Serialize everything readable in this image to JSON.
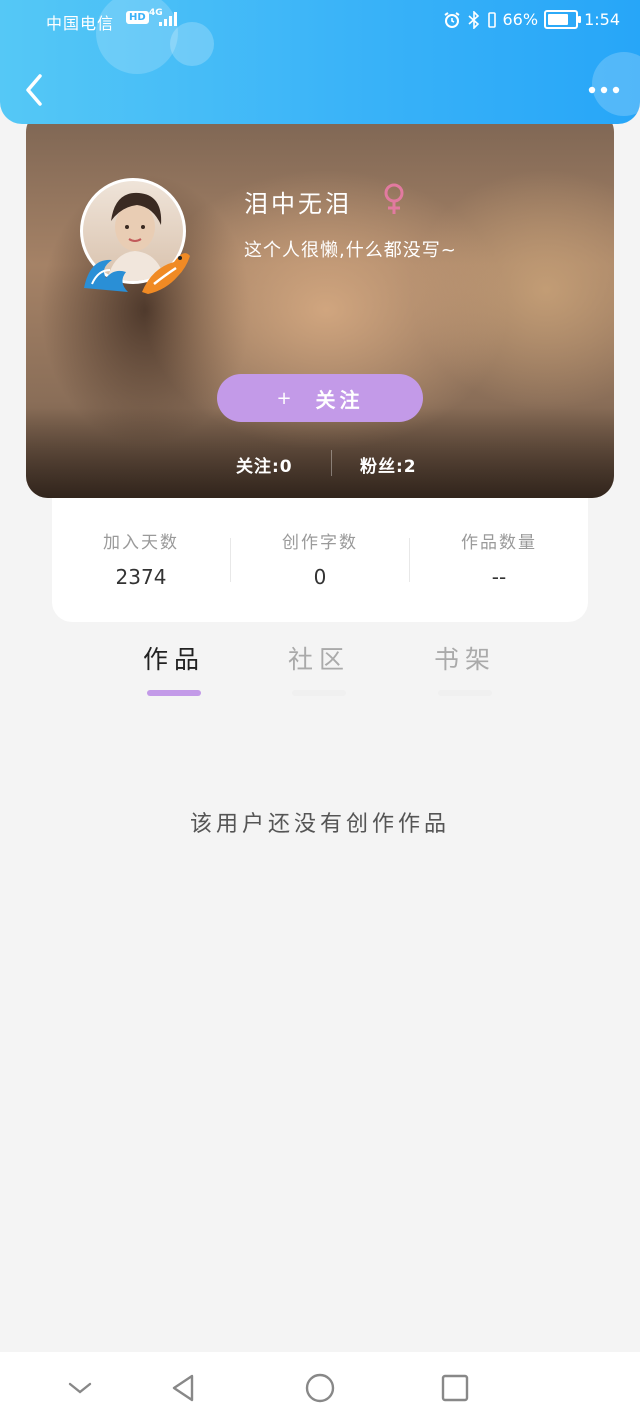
{
  "status_bar": {
    "carrier": "中国电信",
    "hd": "HD",
    "network": "4G",
    "battery_percent": "66%",
    "battery_level": 0.66,
    "time": "1:54"
  },
  "icons": {
    "back": "chevron-left-icon",
    "more": "more-dots-icon",
    "gender": "female-icon",
    "nav_collapse": "chevron-down-icon",
    "nav_back": "triangle-back-icon",
    "nav_home": "circle-home-icon",
    "nav_recent": "square-recent-icon"
  },
  "colors": {
    "header": "#3ab3f8",
    "accent": "#c39ae8",
    "gender": "#e27aa0"
  },
  "profile": {
    "username": "泪中无泪",
    "bio": "这个人很懒,什么都没写~",
    "follow_plus": "+",
    "follow_label": "关注",
    "following_label": "关注:0",
    "fans_label": "粉丝:2"
  },
  "stats": [
    {
      "label": "加入天数",
      "value": "2374"
    },
    {
      "label": "创作字数",
      "value": "0"
    },
    {
      "label": "作品数量",
      "value": "--"
    }
  ],
  "tabs": [
    {
      "label": "作品",
      "active": true
    },
    {
      "label": "社区",
      "active": false
    },
    {
      "label": "书架",
      "active": false
    }
  ],
  "empty_message": "该用户还没有创作作品"
}
